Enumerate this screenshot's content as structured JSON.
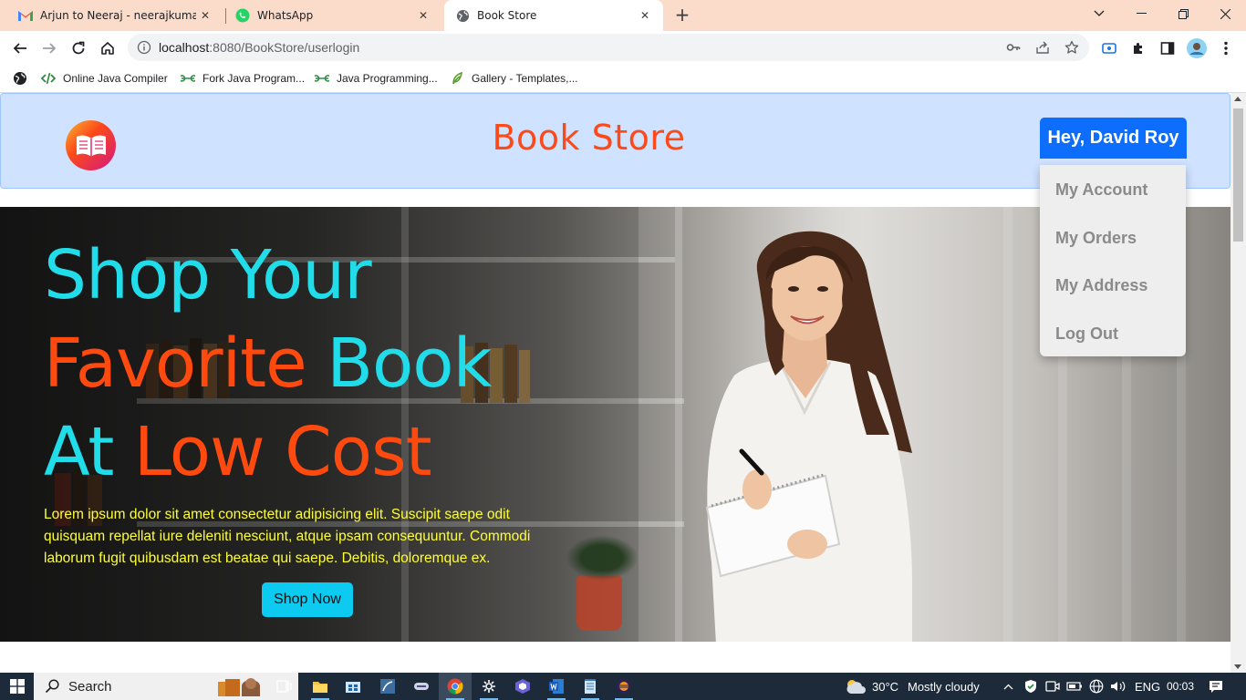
{
  "browser": {
    "tabs": [
      {
        "title": "Arjun to Neeraj - neerajkumarroy",
        "favicon": "gmail-icon",
        "active": false
      },
      {
        "title": "WhatsApp",
        "favicon": "whatsapp-icon",
        "active": false
      },
      {
        "title": "Book Store",
        "favicon": "globe-icon",
        "active": true
      }
    ],
    "url_host": "localhost",
    "url_rest": ":8080/BookStore/userlogin",
    "bookmarks": [
      {
        "label": "Online Java Compiler",
        "icon": "code-icon"
      },
      {
        "label": "Fork Java Program...",
        "icon": "geeks-icon"
      },
      {
        "label": "Java Programming...",
        "icon": "geeks-icon"
      },
      {
        "label": "Gallery - Templates,...",
        "icon": "leaf-icon"
      }
    ]
  },
  "site": {
    "brand": "Book Store",
    "user_button": "Hey, David Roy",
    "menu": [
      "My Account",
      "My Orders",
      "My Address",
      "Log Out"
    ],
    "hero": {
      "line1": "Shop Your",
      "line2_a": "Favorite",
      "line2_b": "Book",
      "line3_a": "At",
      "line3_b": "Low Cost",
      "body": "Lorem ipsum dolor sit amet consectetur adipisicing elit. Suscipit saepe odit quisquam repellat iure deleniti nesciunt, atque ipsam consequuntur. Commodi laborum fugit quibusdam est beatae qui saepe. Debitis, doloremque ex.",
      "cta": "Shop Now"
    }
  },
  "taskbar": {
    "search_label": "Search",
    "weather_temp": "30°C",
    "weather_text": "Mostly cloudy",
    "language": "ENG",
    "time": "00:03"
  },
  "colors": {
    "accent_blue": "#0d6efd",
    "brand_orange": "#fc4a1a",
    "hero_cyan": "#21ddea",
    "hero_text_yellow": "#ffff33",
    "cta_cyan": "#0dcaf0",
    "navbar_bg": "#cfe2ff"
  }
}
